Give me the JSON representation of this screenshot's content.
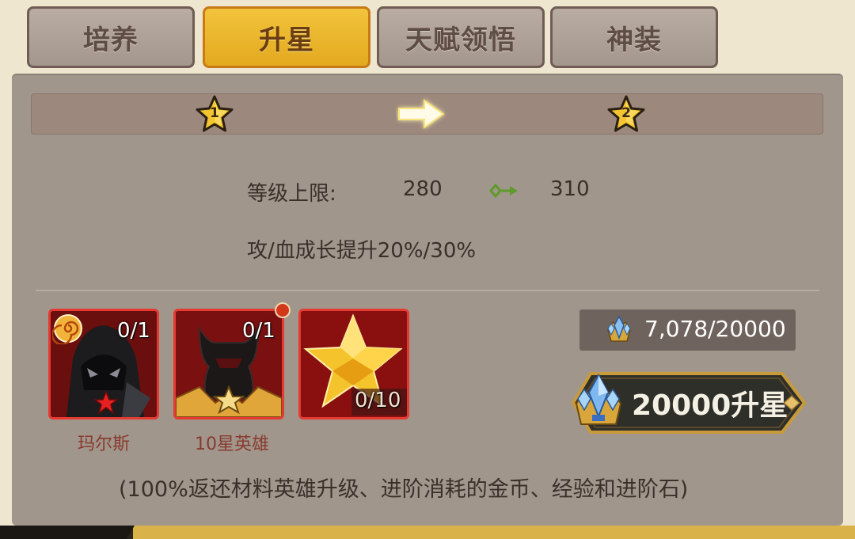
{
  "tabs": [
    {
      "label": "培养",
      "active": false
    },
    {
      "label": "升星",
      "active": true
    },
    {
      "label": "天赋领悟",
      "active": false
    },
    {
      "label": "神装",
      "active": false
    }
  ],
  "star_progress": {
    "from": "1",
    "to": "2"
  },
  "stats": {
    "level_cap_label": "等级上限:",
    "level_cap_from": "280",
    "level_cap_to": "310",
    "growth_text": "攻/血成长提升20%/30%"
  },
  "materials": [
    {
      "name": "玛尔斯",
      "count": "0/1",
      "star_color": "#e52020"
    },
    {
      "name": "10星英雄",
      "count": "0/1",
      "has_notification": true
    },
    {
      "name": "",
      "count": "0/10"
    }
  ],
  "resource": {
    "icon": "crystal-crown-icon",
    "amount": "7,078/20000"
  },
  "upgrade_button": {
    "label": "20000升星",
    "icon": "crystal-crown-icon"
  },
  "note": "(100%返还材料英雄升级、进阶消耗的金币、经验和进阶石)",
  "colors": {
    "active_tab": "#f2c43c",
    "panel": "#a0968b",
    "card_border": "#e53a32"
  }
}
